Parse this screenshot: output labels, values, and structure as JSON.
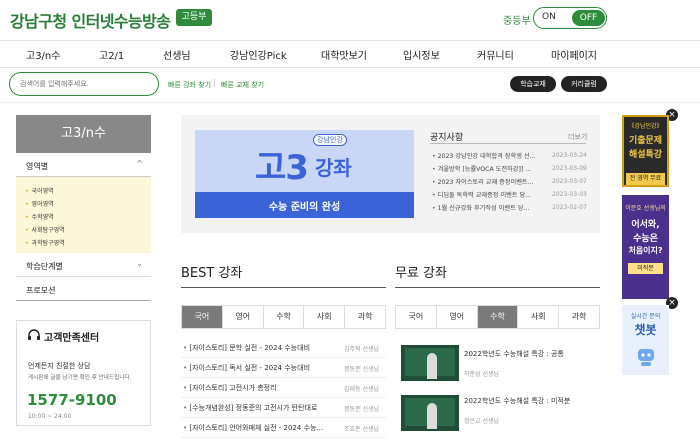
{
  "header": {
    "logo_text": "강남구청 인터넷수능방송",
    "badge": "고등부",
    "level_label": "중등부",
    "toggle_on": "ON",
    "toggle_off": "OFF"
  },
  "nav": [
    "고3/n수",
    "고2/1",
    "선생님",
    "강남인강Pick",
    "대학맛보기",
    "입시정보",
    "커뮤니티",
    "마이페이지"
  ],
  "search": {
    "placeholder": "검색어를 입력해주세요.",
    "quick_lecture": "빠른 강좌 찾기",
    "quick_book": "빠른 교재 찾기",
    "separator": "|",
    "btn_textbook": "학습교재",
    "btn_curriculum": "커리큘럼"
  },
  "sidebar": {
    "title": "고3/n수",
    "section": "영역별",
    "subitems": [
      "국어영역",
      "영어영역",
      "수학영역",
      "사회탐구영역",
      "과학탐구영역"
    ],
    "level_row": "학습단계별",
    "promo_row": "프로모션",
    "chevron_up": "^",
    "chevron_down": "⌄"
  },
  "support": {
    "title": "고객만족센터",
    "subtitle": "언제든지 친절한 상담",
    "desc": "게시판에 글을 남기면 확인 후 안내드립니다.",
    "phone": "1577-9100",
    "hours": "10:00 ~ 24:00"
  },
  "banner": {
    "big": "고3",
    "small": "강좌",
    "tag": "강남인강",
    "caption": "수능 준비의 완성"
  },
  "notice": {
    "title": "공지사항",
    "more": "더보기",
    "items": [
      {
        "text": "2023 강남인강 대학합격 장학생 선...",
        "date": "2023-03-24"
      },
      {
        "text": "겨울방학 [능률VOCA 도전하강]] ...",
        "date": "2023-03-09"
      },
      {
        "text": "2023 자이스토리 교재 증정이벤트...",
        "date": "2023-03-07"
      },
      {
        "text": "디딤돌 독학력 교재증정 이벤트 당...",
        "date": "2023-03-03"
      },
      {
        "text": "1월 신규강좌 후기작성 이벤트 당...",
        "date": "2023-02-07"
      }
    ]
  },
  "best": {
    "title": "BEST 강좌",
    "tabs": [
      "국어",
      "영어",
      "수학",
      "사회",
      "과학"
    ],
    "active_tab": 0,
    "items": [
      {
        "title": "[자이스토리] 문학 실전 - 2024 수능대비",
        "teacher": "김주혁 선생님"
      },
      {
        "title": "[자이스토리] 독서 실전 - 2024 수능대비",
        "teacher": "정동준 선생님"
      },
      {
        "title": "[자이스토리] 고전시가 총정리",
        "teacher": "김태동 선생님"
      },
      {
        "title": "[수능개념완성] 정동준의 고전시가 탄탄대로",
        "teacher": "정동준 선생님"
      },
      {
        "title": "[자이스토리] 언어와매체 실전 - 2024 수능...",
        "teacher": "조효준 선생님"
      }
    ]
  },
  "free": {
    "title": "무료 강좌",
    "tabs": [
      "국어",
      "영어",
      "수학",
      "사회",
      "과학"
    ],
    "active_tab": 2,
    "items": [
      {
        "title": "2022학년도 수능해설 특강 : 공통",
        "teacher": "하준성 선생님"
      },
      {
        "title": "2022학년도 수능해설 특강 : 미적분",
        "teacher": "정은교 선생님"
      }
    ]
  },
  "ads": [
    {
      "l1": "《강남인강》",
      "l2": "기출문제",
      "l3": "해설특강",
      "l4": "전 영역 무료",
      "bg": "#2a2a2a",
      "fg": "#f2c94c"
    },
    {
      "l1": "이문호 선생님의",
      "l2": "어서와,",
      "l3": "수능은",
      "l4": "처음이지?",
      "l5": "미적분",
      "bg": "#4a2f8c",
      "fg": "#ffffff"
    },
    {
      "l1": "실시간 문의",
      "l2": "챗봇",
      "bg": "#e8f1fb",
      "fg": "#2b5fb3"
    }
  ],
  "ad_close": "×",
  "colors": {
    "brand_green": "#2f8c3d",
    "banner_blue": "#3b63d8"
  }
}
